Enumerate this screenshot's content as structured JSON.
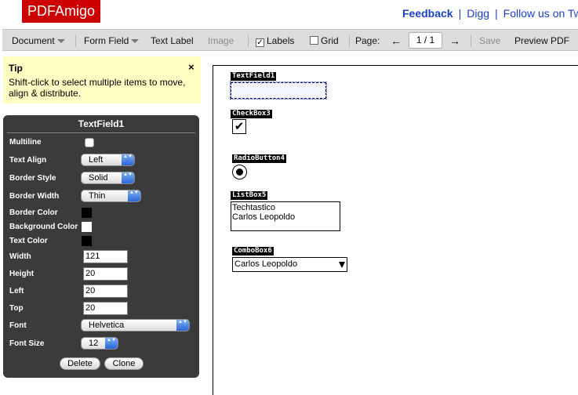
{
  "header": {
    "logo": "PDFAmigo",
    "links": {
      "feedback": "Feedback",
      "sep1": "|",
      "digg": "Digg",
      "sep2": "|",
      "follow": "Follow us on Tw"
    }
  },
  "toolbar": {
    "document": "Document",
    "form_field": "Form Field",
    "text_label": "Text Label",
    "image": "Image",
    "labels": "Labels",
    "labels_checked": true,
    "labels_check_glyph": "✓",
    "grid": "Grid",
    "grid_checked": false,
    "page_label": "Page:",
    "prev_arrow": "←",
    "page_value": "1 / 1",
    "next_arrow": "→",
    "save": "Save",
    "preview": "Preview PDF"
  },
  "tip": {
    "title": "Tip",
    "close": "×",
    "text": "Shift-click to select multiple items to move, align & distribute."
  },
  "properties": {
    "title": "TextField1",
    "multiline_label": "Multiline",
    "multiline_checked": false,
    "text_align_label": "Text Align",
    "text_align_value": "Left",
    "border_style_label": "Border Style",
    "border_style_value": "Solid",
    "border_width_label": "Border Width",
    "border_width_value": "Thin",
    "border_color_label": "Border Color",
    "border_color_value": "#000000",
    "background_color_label": "Background Color",
    "background_color_value": "#ffffff",
    "text_color_label": "Text Color",
    "text_color_value": "#000000",
    "width_label": "Width",
    "width_value": "121",
    "height_label": "Height",
    "height_value": "20",
    "left_label": "Left",
    "left_value": "20",
    "top_label": "Top",
    "top_value": "20",
    "font_label": "Font",
    "font_value": "Helvetica",
    "font_size_label": "Font Size",
    "font_size_value": "12",
    "select_arrows": "▲▼",
    "delete": "Delete",
    "clone": "Clone"
  },
  "canvas": {
    "text_field_label": "TextField1",
    "checkbox_label": "CheckBox3",
    "checkbox_glyph": "✔",
    "radio_label": "RadioButton4",
    "listbox_label": "ListBox5",
    "listbox_items": [
      "Techtastico",
      "Carlos Leopoldo"
    ],
    "combobox_label": "ComboBox6",
    "combobox_value": "Carlos Leopoldo"
  },
  "colors": {
    "logo_bg": "#cc0000",
    "link": "#1a3fcc",
    "tip_bg": "#ffffc4",
    "panel_bg": "#3b3b3b",
    "select_arrow": "#2a66d8"
  }
}
